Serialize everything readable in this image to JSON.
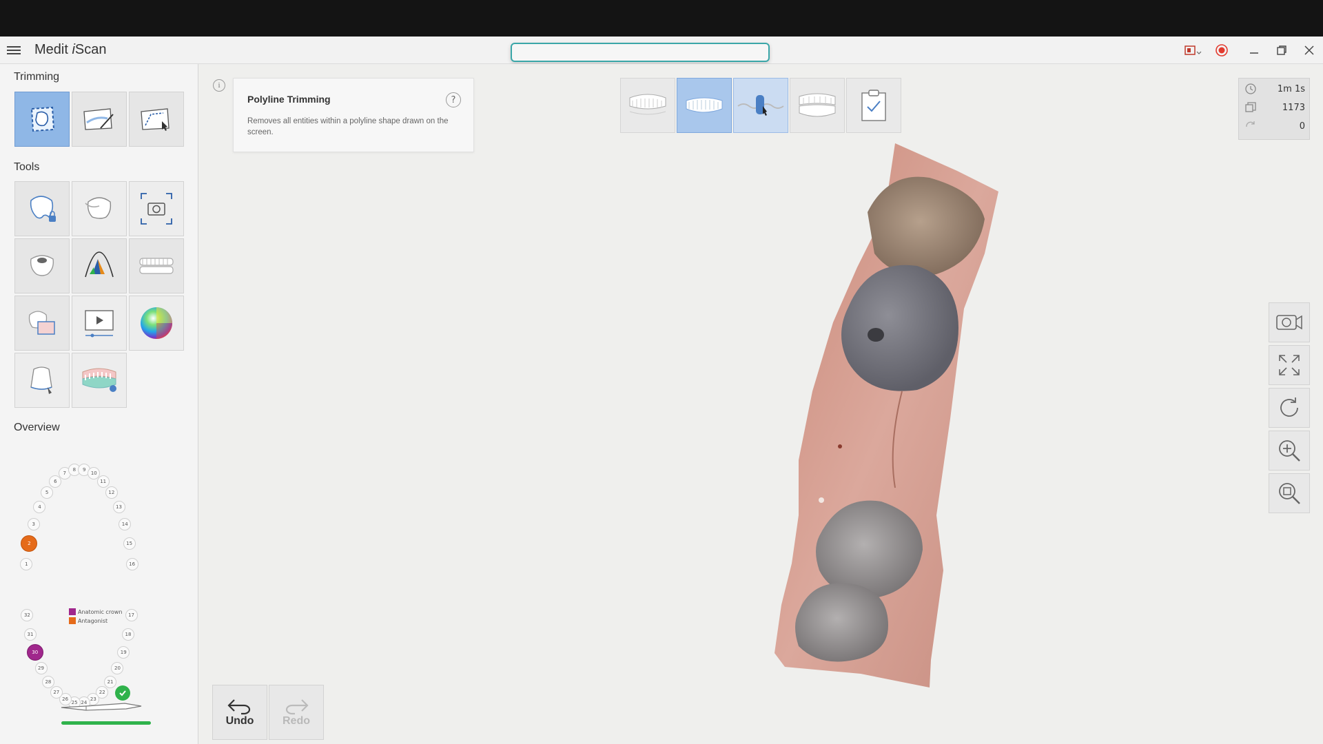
{
  "app": {
    "title_prefix": "Medit ",
    "title_italic": "i",
    "title_suffix": "Scan"
  },
  "sidebar": {
    "trimming_title": "Trimming",
    "tools_title": "Tools",
    "overview_title": "Overview",
    "trimming_tools": [
      "polyline-trimming",
      "brush-trimming",
      "lasso-trimming"
    ],
    "tools": [
      "lock-tooth",
      "tooth-scan",
      "capture",
      "tooth-view",
      "color-map",
      "jaw",
      "mesh-view",
      "play-video",
      "color-sphere",
      "preparation-margin",
      "arch-review"
    ]
  },
  "overview": {
    "upper_teeth": [
      "1",
      "2",
      "3",
      "4",
      "5",
      "6",
      "7",
      "8",
      "9",
      "10",
      "11",
      "12",
      "13",
      "14",
      "15",
      "16"
    ],
    "lower_teeth": [
      "17",
      "18",
      "19",
      "20",
      "21",
      "22",
      "23",
      "24",
      "25",
      "26",
      "27",
      "28",
      "29",
      "30",
      "31",
      "32"
    ],
    "highlight_orange": "2",
    "highlight_purple": "30",
    "legend": [
      {
        "label": "Anatomic crown",
        "color": "#a0278c"
      },
      {
        "label": "Antagonist",
        "color": "#e56b1a"
      }
    ]
  },
  "tip": {
    "title": "Polyline Trimming",
    "description": "Removes all entities within a polyline shape drawn on the screen.",
    "help_symbol": "?",
    "info_symbol": "i"
  },
  "stats": {
    "time": "1m 1s",
    "frames": "1173",
    "rotations": "0"
  },
  "actions": {
    "undo": "Undo",
    "redo": "Redo"
  },
  "colors": {
    "accent": "#3aa6a8",
    "active_tile": "#8fb7e6",
    "record": "#e23a2e",
    "scanner_ok": "#2fb24b"
  }
}
